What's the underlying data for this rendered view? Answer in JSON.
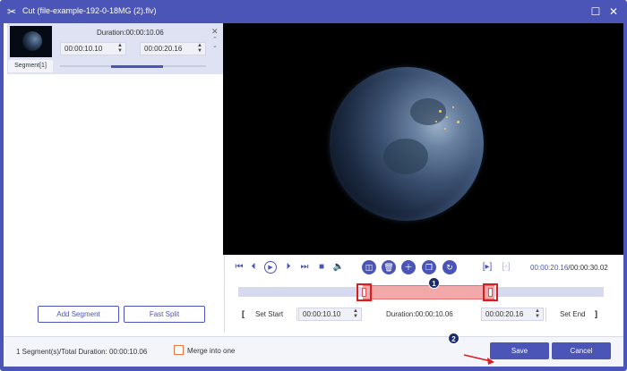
{
  "window": {
    "title": "Cut (file-example-192-0-18MG (2).flv)",
    "app_icon": "scissors-icon",
    "buttons": {
      "maximize": "maximize-icon",
      "close": "close-icon"
    }
  },
  "segment": {
    "label": "Segment[1]",
    "duration": "Duration:00:00:10.06",
    "start": "00:00:10.10",
    "end": "00:00:20.16"
  },
  "left_actions": {
    "add_segment": "Add Segment",
    "fast_split": "Fast Split"
  },
  "playback": {
    "current": "00:00:20.16",
    "total": "/00:00:30.02"
  },
  "annotations": {
    "marker1": "1",
    "marker2": "2"
  },
  "trim": {
    "set_start": "Set Start",
    "start_value": "00:00:10.10",
    "duration": "Duration:00:00:10.06",
    "end_value": "00:00:20.16",
    "set_end": "Set End",
    "bracket_open": "[",
    "bracket_close": "]"
  },
  "footer": {
    "summary": "1 Segment(s)/Total Duration: 00:00:10.06",
    "merge_label": "Merge into one",
    "merge_checked": false,
    "save": "Save",
    "cancel": "Cancel"
  },
  "colors": {
    "accent": "#4b55b8",
    "selection": "#f3a9a9",
    "highlight": "#d81e1e",
    "checkbox": "#e77a45"
  }
}
